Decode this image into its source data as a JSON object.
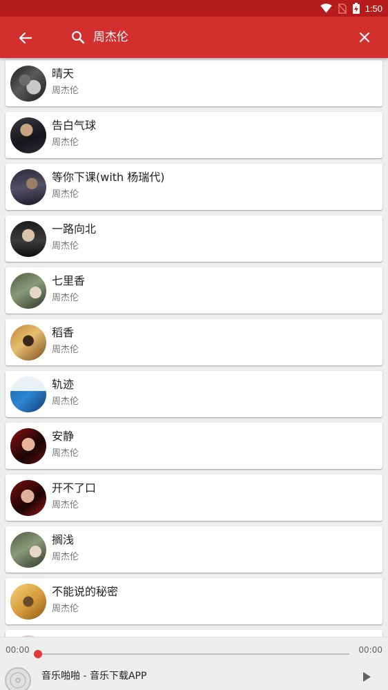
{
  "status_bar": {
    "time": "1:50"
  },
  "app_bar": {
    "query": "周杰伦",
    "colors": {
      "bar": "#d32f2f",
      "status": "#b71c1c"
    }
  },
  "songs": [
    {
      "title": "晴天",
      "artist": "周杰伦",
      "cover": "album-cover-1"
    },
    {
      "title": "告白气球",
      "artist": "周杰伦",
      "cover": "album-cover-2"
    },
    {
      "title": "等你下课(with 杨瑞代)",
      "artist": "周杰伦",
      "cover": "album-cover-3"
    },
    {
      "title": "一路向北",
      "artist": "周杰伦",
      "cover": "album-cover-4"
    },
    {
      "title": "七里香",
      "artist": "周杰伦",
      "cover": "album-cover-5"
    },
    {
      "title": "稻香",
      "artist": "周杰伦",
      "cover": "album-cover-6"
    },
    {
      "title": "轨迹",
      "artist": "周杰伦",
      "cover": "album-cover-7"
    },
    {
      "title": "安静",
      "artist": "周杰伦",
      "cover": "album-cover-8"
    },
    {
      "title": "开不了口",
      "artist": "周杰伦",
      "cover": "album-cover-9"
    },
    {
      "title": "搁浅",
      "artist": "周杰伦",
      "cover": "album-cover-10"
    },
    {
      "title": "不能说的秘密",
      "artist": "周杰伦",
      "cover": "album-cover-11"
    },
    {
      "title": "",
      "artist": "",
      "cover": "album-cover-12"
    }
  ],
  "player": {
    "current_time": "00:00",
    "total_time": "00:00",
    "progress": 0,
    "now_playing": "音乐啪啪 - 音乐下载APP",
    "accent": "#e53935"
  }
}
